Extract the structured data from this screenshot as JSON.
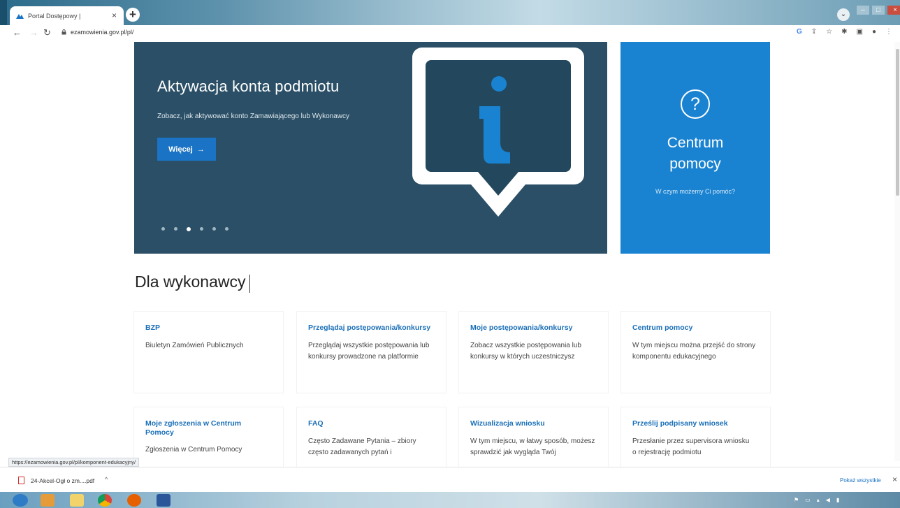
{
  "browser": {
    "tab_title": "Portal Dostępowy |",
    "tab_close": "×",
    "new_tab": "+",
    "url": "ezamowienia.gov.pl/pl/",
    "status_url": "https://ezamowienia.gov.pl/pl/komponent-edukacyjny/"
  },
  "hero": {
    "title": "Aktywacja konta podmiotu",
    "text": "Zobacz, jak aktywować konto Zamawiającego lub Wykonawcy",
    "button_label": "Więcej",
    "button_arrow": "→",
    "slide_count": 6,
    "active_slide": 3,
    "info_glyph": "i"
  },
  "help": {
    "icon": "?",
    "title": "Centrum pomocy",
    "subtitle": "W czym możemy Ci pomóc?"
  },
  "section": {
    "title": "Dla wykonawcy"
  },
  "cards": [
    {
      "title": "BZP",
      "text": "Biuletyn Zamówień Publicznych"
    },
    {
      "title": "Przeglądaj postępowania/konkursy",
      "text": "Przeglądaj wszystkie postępowania lub konkursy prowadzone na platformie"
    },
    {
      "title": "Moje postępowania/konkursy",
      "text": "Zobacz wszystkie postępowania lub konkursy w których uczestniczysz"
    },
    {
      "title": "Centrum pomocy",
      "text": "W tym miejscu można przejść do strony komponentu edukacyjnego"
    },
    {
      "title": "Moje zgłoszenia w Centrum Pomocy",
      "text": "Zgłoszenia w Centrum Pomocy"
    },
    {
      "title": "FAQ",
      "text": "Często Zadawane Pytania – zbiory często zadawanych pytań i"
    },
    {
      "title": "Wizualizacja wniosku",
      "text": "W tym miejscu, w łatwy sposób, możesz sprawdzić jak wygląda Twój"
    },
    {
      "title": "Prześlij podpisany wniosek",
      "text": "Przesłanie przez supervisora wniosku o rejestrację podmiotu"
    }
  ],
  "downloads": {
    "file_name": "24-Akcel-Ogł o zm....pdf",
    "show_all": "Pokaż wszystkie",
    "close": "×"
  },
  "colors": {
    "hero_bg": "#2a4f66",
    "accent_blue": "#1a73c4",
    "help_panel": "#1a83d1",
    "card_title": "#1a6fb8"
  }
}
